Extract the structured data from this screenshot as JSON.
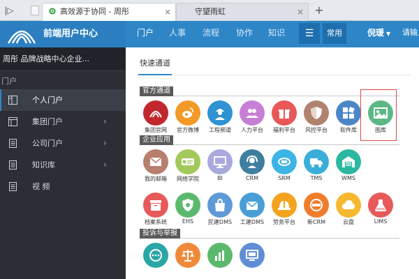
{
  "browser": {
    "tabs": [
      {
        "title": "高效源于协同 - 周彤",
        "active": true
      },
      {
        "title": "守望雨虹",
        "active": false
      }
    ],
    "new_tab_label": "+",
    "close_label": "×",
    "sidebar_toggle_label": "|▷"
  },
  "topnav": {
    "brand_name": "前端用户中心",
    "items": [
      "门户",
      "人事",
      "流程",
      "协作",
      "知识"
    ],
    "active_item": "门户",
    "common_label": "常用",
    "user_name": "倪瑗",
    "user_link": "请输入"
  },
  "sidebar": {
    "company": "周彤 品牌战略中心企业...",
    "section": "门户",
    "items": [
      {
        "label": "个人门户",
        "active": true,
        "arrow": false,
        "icon": "layout-icon"
      },
      {
        "label": "集团门户",
        "active": false,
        "arrow": true,
        "icon": "window-icon"
      },
      {
        "label": "公司门户",
        "active": false,
        "arrow": true,
        "icon": "document-icon"
      },
      {
        "label": "知识库",
        "active": false,
        "arrow": true,
        "icon": "document-icon"
      },
      {
        "label": "视 频",
        "active": false,
        "arrow": false,
        "icon": "document-icon"
      }
    ],
    "arrow_glyph": "›"
  },
  "main": {
    "tab_label": "快速通道",
    "sections": [
      {
        "title": "官方通道",
        "apps": [
          {
            "label": "集团官网",
            "color": "#c0282d",
            "icon": "brand-logo-icon"
          },
          {
            "label": "官方微博",
            "color": "#f39a26",
            "icon": "weibo-icon"
          },
          {
            "label": "工程频道",
            "color": "#2e92d3",
            "icon": "engineer-icon"
          },
          {
            "label": "人力平台",
            "color": "#c77fd6",
            "icon": "people-icon"
          },
          {
            "label": "福利平台",
            "color": "#e85858",
            "icon": "gift-icon"
          },
          {
            "label": "风控平台",
            "color": "#b0836e",
            "icon": "shield-icon"
          },
          {
            "label": "软件库",
            "color": "#4d86c7",
            "icon": "blocks-icon"
          },
          {
            "label": "图库",
            "color": "#5bb885",
            "icon": "image-icon"
          }
        ]
      },
      {
        "title": "企业应用",
        "apps": [
          {
            "label": "我的邮箱",
            "color": "#b77f6e",
            "icon": "mail-icon"
          },
          {
            "label": "网络学院",
            "color": "#a2c95a",
            "icon": "elearning-icon"
          },
          {
            "label": "BI",
            "color": "#a9a9dd",
            "icon": "monitor-icon"
          },
          {
            "label": "CRM",
            "color": "#3e7fa0",
            "icon": "headset-icon"
          },
          {
            "label": "SRM",
            "color": "#3cb5e6",
            "icon": "srm-icon"
          },
          {
            "label": "TMS",
            "color": "#3aaed9",
            "icon": "truck-icon"
          },
          {
            "label": "WMS",
            "color": "#2bb8a0",
            "icon": "warehouse-icon"
          }
        ]
      },
      {
        "title": "",
        "apps": [
          {
            "label": "档案系统",
            "color": "#e85a5a",
            "icon": "archive-icon"
          },
          {
            "label": "EHS",
            "color": "#5bb96e",
            "icon": "ehs-icon"
          },
          {
            "label": "民建DMS",
            "color": "#5f9ad6",
            "icon": "bag-icon"
          },
          {
            "label": "工建DMS",
            "color": "#4a9ed6",
            "icon": "mail-open-icon"
          },
          {
            "label": "劳务平台",
            "color": "#f3a31f",
            "icon": "helmet-icon"
          },
          {
            "label": "新CRM",
            "color": "#f07c2a",
            "icon": "crm-icon"
          },
          {
            "label": "云盘",
            "color": "#f5b82e",
            "icon": "cloud-icon"
          },
          {
            "label": "LIMS",
            "color": "#e85a5a",
            "icon": "flask-icon"
          }
        ]
      },
      {
        "title": "投诉与举报",
        "apps": [
          {
            "label": "",
            "color": "#2aa6a6",
            "icon": "chat-phone-icon"
          },
          {
            "label": "",
            "color": "#f08a3a",
            "icon": "scales-icon"
          },
          {
            "label": "",
            "color": "#5bb96e",
            "icon": "chart-icon"
          },
          {
            "label": "",
            "color": "#5f8ed6",
            "icon": "screen-icon"
          }
        ]
      }
    ]
  },
  "colors": {
    "accent": "#2e86c7",
    "sidebar_bg": "#2b2e35",
    "highlight": "#e04848"
  }
}
